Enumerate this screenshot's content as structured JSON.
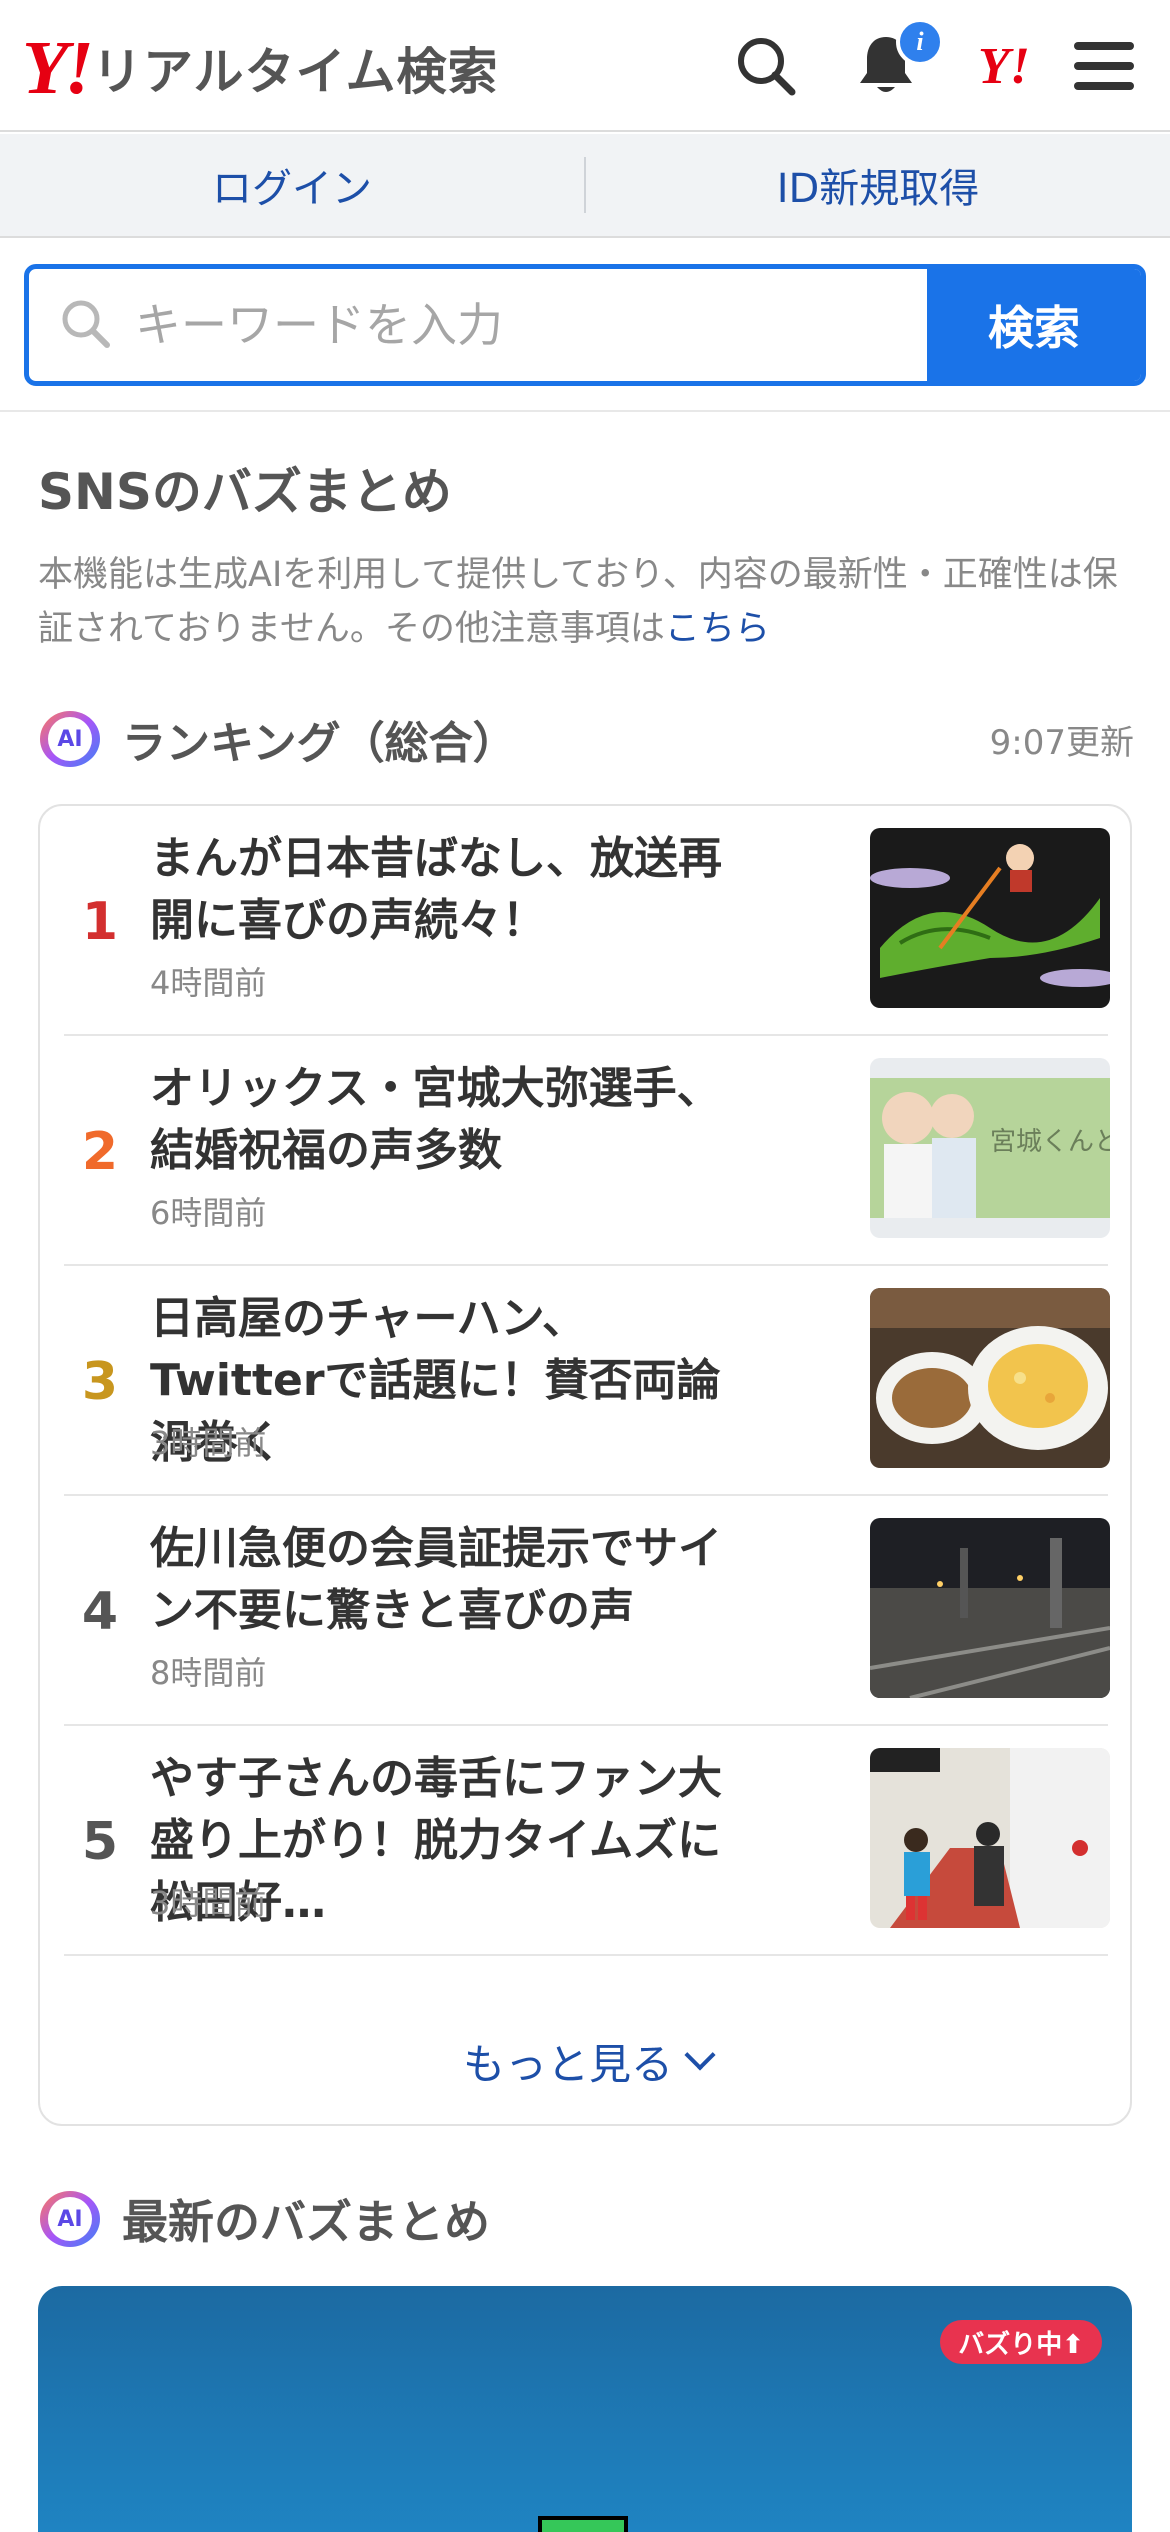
{
  "header": {
    "logo_mark": "Y!",
    "logo_text": "リアルタイム検索",
    "notification_badge": "i",
    "yj_logo": "Y!"
  },
  "account": {
    "login": "ログイン",
    "register": "ID新規取得"
  },
  "search": {
    "placeholder": "キーワードを入力",
    "button": "検索"
  },
  "buzz_section": {
    "title": "SNSのバズまとめ",
    "disclaimer": "本機能は生成AIを利用して提供しており、内容の最新性・正確性は保証されておりません。その他注意事項は",
    "disclaimer_link": "こちら"
  },
  "ranking": {
    "ai_label": "AI",
    "title": "ランキング（総合）",
    "updated": "9:07更新",
    "items": [
      {
        "rank": "1",
        "title": "まんが日本昔ばなし、放送再開に喜びの声続々！",
        "time": "4時間前",
        "rank_color": "#d32f2f"
      },
      {
        "rank": "2",
        "title": "オリックス・宮城大弥選手、結婚祝福の声多数",
        "time": "6時間前",
        "rank_color": "#f06a2b"
      },
      {
        "rank": "3",
        "title": "日高屋のチャーハン、Twitterで話題に！賛否両論渦巻く",
        "time": "3時間前",
        "rank_color": "#c8961e"
      },
      {
        "rank": "4",
        "title": "佐川急便の会員証提示でサイン不要に驚きと喜びの声",
        "time": "8時間前",
        "rank_color": "#555555"
      },
      {
        "rank": "5",
        "title": "やす子さんの毒舌にファン大盛り上がり！脱力タイムズに松田好…",
        "time": "3時間前",
        "rank_color": "#555555"
      }
    ],
    "more": "もっと見る"
  },
  "latest": {
    "ai_label": "AI",
    "title": "最新のバズまとめ",
    "badge": "バズり中⬆"
  },
  "colors": {
    "accent": "#1a73e8",
    "brand_red": "#e60012",
    "link": "#1d4fa8"
  }
}
